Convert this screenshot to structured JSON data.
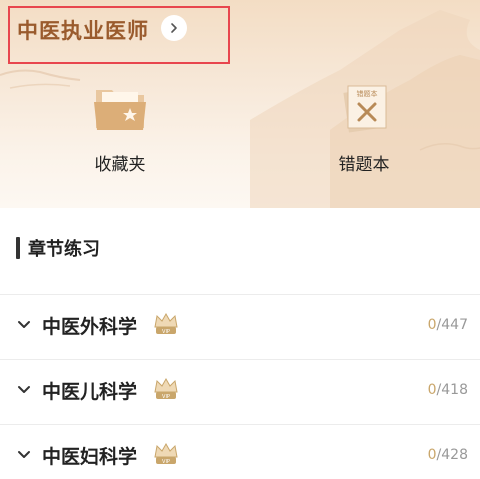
{
  "header": {
    "title": "中医执业医师"
  },
  "shortcuts": [
    {
      "label": "收藏夹",
      "icon": "folder-star-icon"
    },
    {
      "label": "错题本",
      "icon": "wrong-book-icon",
      "icon_text": "错题本"
    }
  ],
  "section": {
    "title": "章节练习"
  },
  "chapters": [
    {
      "name": "中医外科学",
      "done": "0",
      "total": "/447"
    },
    {
      "name": "中医儿科学",
      "done": "0",
      "total": "/418"
    },
    {
      "name": "中医妇科学",
      "done": "0",
      "total": "/428"
    }
  ],
  "colors": {
    "title": "#9a5b2d",
    "accent": "#c9a66b",
    "highlight_box": "#e8464e"
  }
}
